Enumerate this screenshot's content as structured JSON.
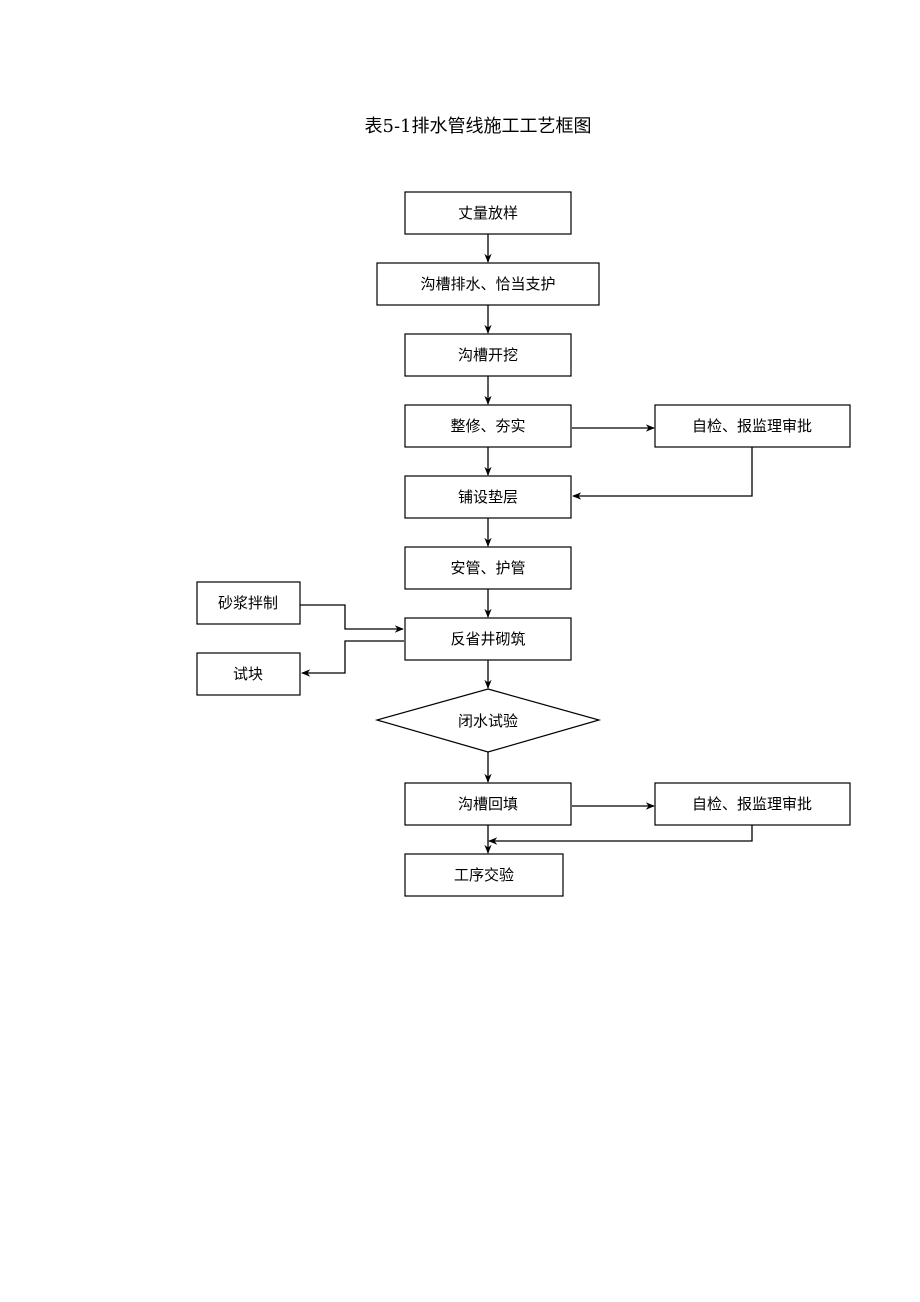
{
  "title": "表5-1排水管线施工工艺框图",
  "nodes": {
    "survey": "丈量放样",
    "drainage": "沟槽排水、恰当支护",
    "excavation": "沟槽开挖",
    "trim": "整修、夯实",
    "check1": "自检、报监理审批",
    "bedding": "铺设垫层",
    "pipe": "安管、护管",
    "mortar": "砂浆拌制",
    "well": "反省井砌筑",
    "testblock": "试块",
    "watertest": "闭水试验",
    "backfill": "沟槽回填",
    "check2": "自检、报监理审批",
    "handover": "工序交验"
  },
  "edges": [
    {
      "from": "survey",
      "to": "drainage"
    },
    {
      "from": "drainage",
      "to": "excavation"
    },
    {
      "from": "excavation",
      "to": "trim"
    },
    {
      "from": "trim",
      "to": "check1"
    },
    {
      "from": "trim",
      "to": "bedding"
    },
    {
      "from": "check1",
      "to": "bedding"
    },
    {
      "from": "bedding",
      "to": "pipe"
    },
    {
      "from": "pipe",
      "to": "well"
    },
    {
      "from": "mortar",
      "to": "well"
    },
    {
      "from": "well",
      "to": "testblock"
    },
    {
      "from": "well",
      "to": "watertest"
    },
    {
      "from": "watertest",
      "to": "backfill"
    },
    {
      "from": "backfill",
      "to": "check2"
    },
    {
      "from": "backfill",
      "to": "handover"
    },
    {
      "from": "check2",
      "to": "handover"
    }
  ]
}
